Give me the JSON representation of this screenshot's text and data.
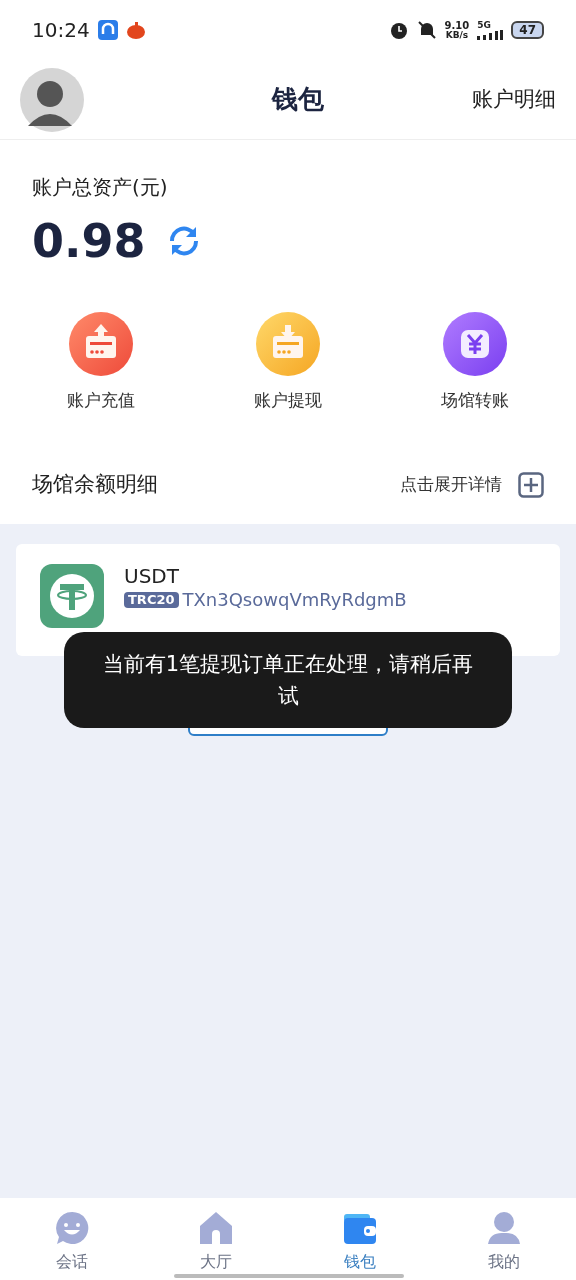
{
  "status_bar": {
    "time": "10:24",
    "net_speed": "9.10",
    "net_unit": "KB/s",
    "network": "5G",
    "battery": "47"
  },
  "header": {
    "title": "钱包",
    "action": "账户明细"
  },
  "balance": {
    "label": "账户总资产(元)",
    "amount": "0.98"
  },
  "actions": [
    {
      "label": "账户充值",
      "kind": "deposit"
    },
    {
      "label": "账户提现",
      "kind": "withdraw"
    },
    {
      "label": "场馆转账",
      "kind": "transfer"
    }
  ],
  "venue": {
    "title": "场馆余额明细",
    "expand": "点击展开详情",
    "expanded": false
  },
  "account": {
    "name": "USDT",
    "network": "TRC20",
    "address": "TXn3QsowqVmRyRdgmB"
  },
  "toast": "当前有1笔提现订单正在处理，请稍后再试",
  "tabs": [
    {
      "label": "会话",
      "kind": "chat",
      "selected": false
    },
    {
      "label": "大厅",
      "kind": "home",
      "selected": false
    },
    {
      "label": "钱包",
      "kind": "wallet",
      "selected": true
    },
    {
      "label": "我的",
      "kind": "profile",
      "selected": false
    }
  ]
}
